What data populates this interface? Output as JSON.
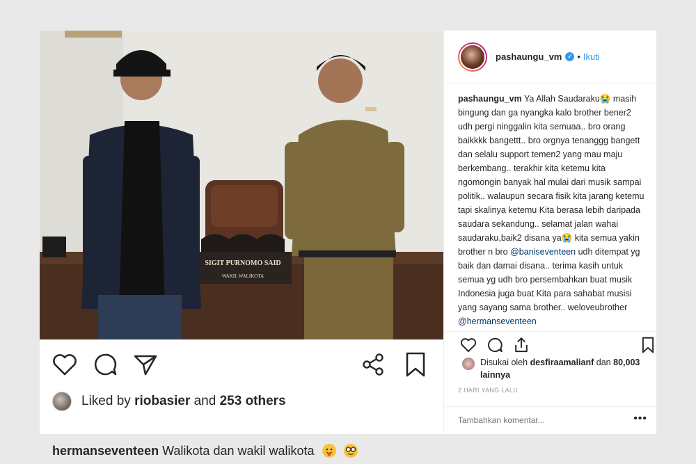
{
  "post": {
    "liked_by_user": "riobasier",
    "liked_others": "253 others",
    "liked_by_prefix": "Liked by",
    "liked_and": "and",
    "caption_user": "hermanseventeen",
    "caption_text": "Walikota dan wakil walikota",
    "photo": {
      "nameplate_name": "SIGIT PURNOMO SAID",
      "nameplate_title": "WAKIL WALIKOTA"
    }
  },
  "sidebar": {
    "username": "pashaungu_vm",
    "separator": "•",
    "follow_label": "Ikuti",
    "comment_user": "pashaungu_vm",
    "comment_part1": "Ya Allah Saudaraku😭 masih bingung dan ga nyangka kalo brother bener2 udh pergi ninggalin kita semuaa.. bro orang baikkkk bangettt.. bro orgnya tenanggg bangett dan selalu support temen2 yang mau maju berkembang.. terakhir kita ketemu kita ngomongin banyak hal mulai dari musik sampai politik.. walaupun secara fisik kita jarang ketemu tapi skalinya ketemu Kita berasa lebih daripada saudara sekandung.. selamat jalan wahai saudaraku,baik2 disana ya😭 kita semua yakin brother n bro",
    "mention1": "@baniseventeen",
    "comment_part2": "udh ditempat yg baik dan damai disana.. terima kasih untuk semua yg udh bro persembahkan buat musik Indonesia juga buat Kita para sahabat musisi yang sayang sama brother.. weloveubrother",
    "mention2": "@hermanseventeen",
    "likes_prefix": "Disukai oleh",
    "likes_user": "desfiraamalianf",
    "likes_and": "dan",
    "likes_count": "80,003 lainnya",
    "time": "2 HARI YANG LALU",
    "add_comment_placeholder": "Tambahkan komentar...",
    "more_label": "•••"
  },
  "colors": {
    "accent": "#3897f0",
    "text": "#262626",
    "muted": "#999999",
    "mention": "#003569"
  }
}
